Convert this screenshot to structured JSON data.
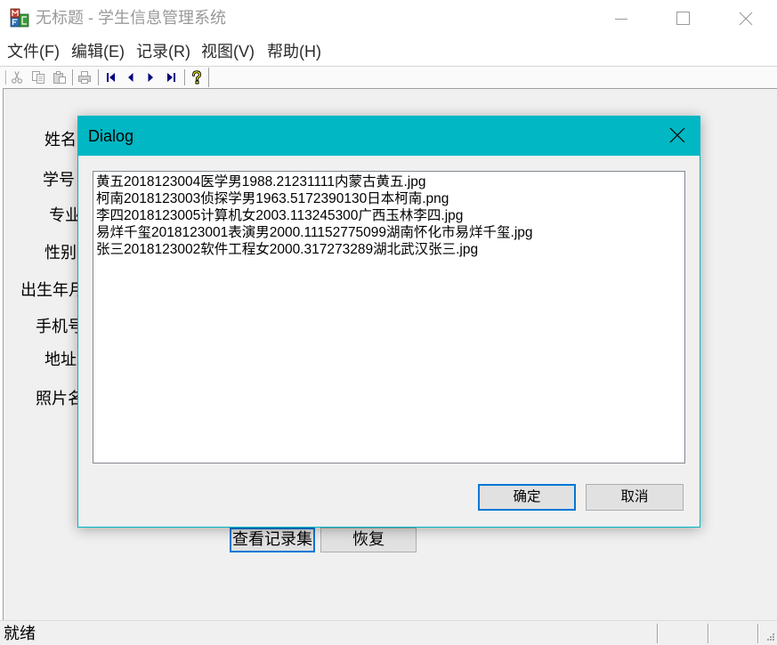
{
  "window": {
    "title": "无标题 - 学生信息管理系统",
    "icon": "mfc-app-icon",
    "controls": [
      "minimize-icon",
      "maximize-icon",
      "close-icon"
    ]
  },
  "menu": {
    "items": [
      {
        "label": "文件(F)"
      },
      {
        "label": "编辑(E)"
      },
      {
        "label": "记录(R)"
      },
      {
        "label": "视图(V)"
      },
      {
        "label": "帮助(H)"
      }
    ]
  },
  "toolbar": {
    "buttons": [
      {
        "icon": "cut-icon",
        "enabled": false
      },
      {
        "icon": "copy-icon",
        "enabled": false
      },
      {
        "icon": "paste-icon",
        "enabled": false
      },
      {
        "icon": "print-icon",
        "enabled": false
      },
      {
        "icon": "first-record-icon",
        "enabled": true
      },
      {
        "icon": "previous-record-icon",
        "enabled": true
      },
      {
        "icon": "next-record-icon",
        "enabled": true
      },
      {
        "icon": "last-record-icon",
        "enabled": true
      },
      {
        "icon": "context-help-icon",
        "enabled": true
      }
    ]
  },
  "form": {
    "labels": {
      "name": "姓名",
      "student_id": "学号",
      "major": "专业",
      "gender": "性别",
      "birth": "出生年月",
      "phone": "手机号",
      "address": "地址",
      "photo": "照片名"
    },
    "buttons": {
      "view_records": "查看记录集",
      "restore": "恢复"
    }
  },
  "dialog": {
    "title": "Dialog",
    "close_icon": "close-icon",
    "records": [
      "黄五2018123004医学男1988.21231111内蒙古黄五.jpg",
      "柯南2018123003侦探学男1963.5172390130日本柯南.png",
      "李四2018123005计算机女2003.113245300广西玉林李四.jpg",
      "易烊千玺2018123001表演男2000.11152775099湖南怀化市易烊千玺.jpg",
      "张三2018123002软件工程女2000.317273289湖北武汉张三.jpg"
    ],
    "ok_label": "确定",
    "cancel_label": "取消"
  },
  "status_bar": {
    "text": "就绪"
  },
  "colors": {
    "dialog_accent": "#00b7c3",
    "default_button_border": "#0078d7",
    "inactive_title": "#999999",
    "nav_icon": "#000080",
    "disabled_icon": "#a0a0a0"
  }
}
